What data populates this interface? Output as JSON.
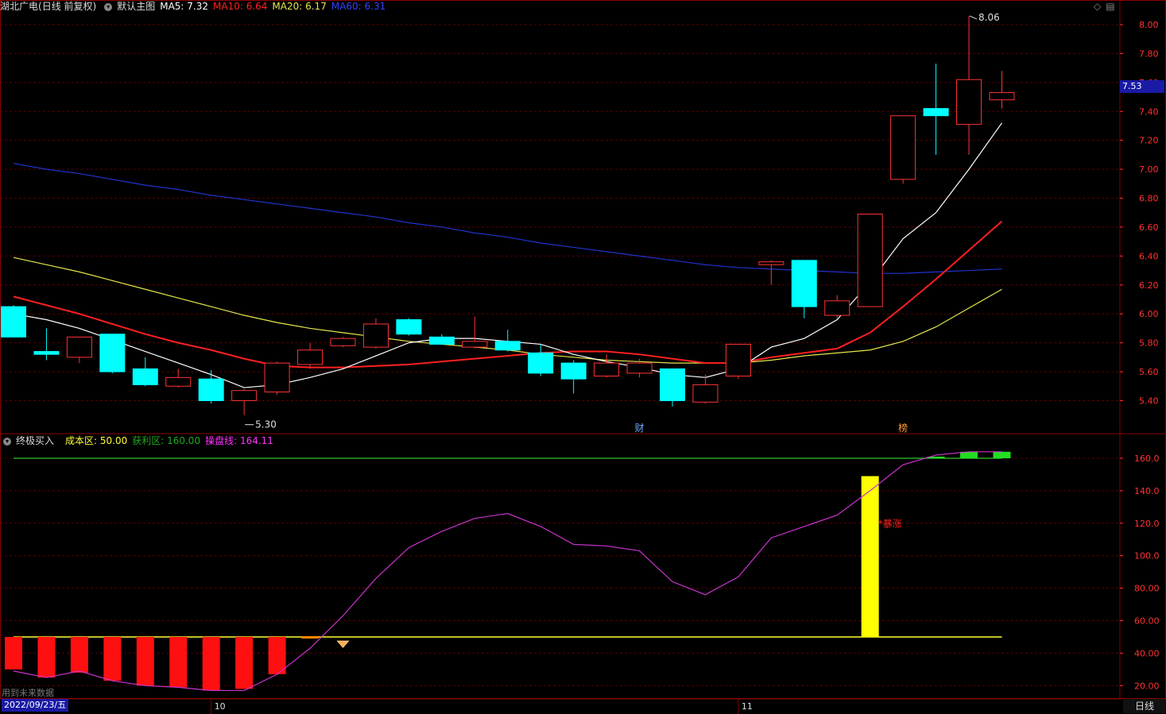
{
  "header": {
    "stock_name": "湖北广电",
    "adjust": "(日线 前复权)",
    "template_label": "默认主图",
    "ma5": "MA5: 7.32",
    "ma10": "MA10: 6.64",
    "ma20": "MA20: 6.17",
    "ma60": "MA60: 6.31"
  },
  "top_icons": {
    "diamond": "◇",
    "square": "▤"
  },
  "indicator_header": {
    "name": "终极买入",
    "cost_zone": "成本区: 50.00",
    "profit_zone": "获利区: 160.00",
    "operation_line": "操盘线: 164.11"
  },
  "price_axis": {
    "labels": [
      "8.00",
      "7.80",
      "7.60",
      "7.40",
      "7.20",
      "7.00",
      "6.80",
      "6.60",
      "6.40",
      "6.20",
      "6.00",
      "5.80",
      "5.60",
      "5.40"
    ],
    "values": [
      8.0,
      7.8,
      7.6,
      7.4,
      7.2,
      7.0,
      6.8,
      6.6,
      6.4,
      6.2,
      6.0,
      5.8,
      5.6,
      5.4
    ]
  },
  "current_price_tag": "7.53",
  "high_label": "8.06",
  "low_label": "5.30",
  "event_markers": [
    "财",
    "榜"
  ],
  "indicator_axis": {
    "labels": [
      "160.0",
      "140.0",
      "120.0",
      "100.0",
      "80.00",
      "60.00",
      "40.00",
      "20.00"
    ],
    "values": [
      160,
      140,
      120,
      100,
      80,
      60,
      40,
      20
    ]
  },
  "surge_label": "*暴涨",
  "bottom": {
    "future_data_note": "用到未来数据",
    "date": "2022/09/23/五",
    "month_oct": "10",
    "month_nov": "11",
    "period": "日线"
  },
  "colors": {
    "up": "#ff3333",
    "down": "#00ffff",
    "ma5": "#ffffff",
    "ma10": "#ff2020",
    "ma20": "#e6e64d",
    "ma60": "#2233cc",
    "grid": "#5a0000",
    "axis_text": "#ff3333"
  },
  "chart_data": {
    "type": "candlestick",
    "candles": [
      {
        "o": 6.05,
        "h": 6.06,
        "l": 5.84,
        "c": 5.84
      },
      {
        "o": 5.74,
        "h": 5.9,
        "l": 5.68,
        "c": 5.72
      },
      {
        "o": 5.7,
        "h": 5.84,
        "l": 5.66,
        "c": 5.84
      },
      {
        "o": 5.86,
        "h": 5.86,
        "l": 5.59,
        "c": 5.6
      },
      {
        "o": 5.62,
        "h": 5.7,
        "l": 5.5,
        "c": 5.51
      },
      {
        "o": 5.5,
        "h": 5.62,
        "l": 5.49,
        "c": 5.56
      },
      {
        "o": 5.55,
        "h": 5.61,
        "l": 5.38,
        "c": 5.4
      },
      {
        "o": 5.4,
        "h": 5.48,
        "l": 5.3,
        "c": 5.47
      },
      {
        "o": 5.46,
        "h": 5.67,
        "l": 5.44,
        "c": 5.66
      },
      {
        "o": 5.65,
        "h": 5.8,
        "l": 5.62,
        "c": 5.75
      },
      {
        "o": 5.78,
        "h": 5.84,
        "l": 5.77,
        "c": 5.83
      },
      {
        "o": 5.77,
        "h": 5.97,
        "l": 5.76,
        "c": 5.93
      },
      {
        "o": 5.96,
        "h": 5.97,
        "l": 5.85,
        "c": 5.86
      },
      {
        "o": 5.84,
        "h": 5.86,
        "l": 5.79,
        "c": 5.79
      },
      {
        "o": 5.77,
        "h": 5.98,
        "l": 5.76,
        "c": 5.81
      },
      {
        "o": 5.81,
        "h": 5.89,
        "l": 5.74,
        "c": 5.75
      },
      {
        "o": 5.73,
        "h": 5.79,
        "l": 5.57,
        "c": 5.59
      },
      {
        "o": 5.66,
        "h": 5.68,
        "l": 5.45,
        "c": 5.55
      },
      {
        "o": 5.57,
        "h": 5.72,
        "l": 5.56,
        "c": 5.66
      },
      {
        "o": 5.59,
        "h": 5.69,
        "l": 5.56,
        "c": 5.66
      },
      {
        "o": 5.62,
        "h": 5.62,
        "l": 5.36,
        "c": 5.4
      },
      {
        "o": 5.39,
        "h": 5.58,
        "l": 5.38,
        "c": 5.51
      },
      {
        "o": 5.57,
        "h": 5.79,
        "l": 5.55,
        "c": 5.79
      },
      {
        "o": 6.34,
        "h": 6.37,
        "l": 6.2,
        "c": 6.36
      },
      {
        "o": 6.37,
        "h": 6.37,
        "l": 5.97,
        "c": 6.05
      },
      {
        "o": 5.99,
        "h": 6.13,
        "l": 5.97,
        "c": 6.09
      },
      {
        "o": 6.05,
        "h": 6.69,
        "l": 6.05,
        "c": 6.69
      },
      {
        "o": 6.93,
        "h": 7.37,
        "l": 6.9,
        "c": 7.37
      },
      {
        "o": 7.42,
        "h": 7.73,
        "l": 7.1,
        "c": 7.37
      },
      {
        "o": 7.31,
        "h": 8.06,
        "l": 7.1,
        "c": 7.62
      },
      {
        "o": 7.48,
        "h": 7.68,
        "l": 7.42,
        "c": 7.53
      }
    ],
    "ma5": [
      6.0,
      5.96,
      5.9,
      5.82,
      5.74,
      5.66,
      5.58,
      5.49,
      5.51,
      5.56,
      5.62,
      5.71,
      5.8,
      5.83,
      5.83,
      5.81,
      5.79,
      5.72,
      5.67,
      5.63,
      5.58,
      5.56,
      5.62,
      5.77,
      5.83,
      5.96,
      6.22,
      6.52,
      6.7,
      7.0,
      7.32
    ],
    "ma10": [
      6.12,
      6.06,
      6.0,
      5.93,
      5.86,
      5.8,
      5.75,
      5.69,
      5.64,
      5.63,
      5.63,
      5.64,
      5.65,
      5.67,
      5.69,
      5.71,
      5.73,
      5.74,
      5.74,
      5.72,
      5.69,
      5.66,
      5.66,
      5.7,
      5.73,
      5.76,
      5.87,
      6.05,
      6.24,
      6.44,
      6.64
    ],
    "ma20": [
      6.39,
      6.34,
      6.29,
      6.23,
      6.17,
      6.11,
      6.05,
      5.99,
      5.94,
      5.9,
      5.87,
      5.84,
      5.81,
      5.79,
      5.77,
      5.75,
      5.72,
      5.7,
      5.68,
      5.67,
      5.66,
      5.66,
      5.66,
      5.68,
      5.71,
      5.73,
      5.75,
      5.81,
      5.91,
      6.04,
      6.17
    ],
    "ma60": [
      7.04,
      7.0,
      6.97,
      6.93,
      6.89,
      6.86,
      6.82,
      6.79,
      6.76,
      6.73,
      6.7,
      6.67,
      6.63,
      6.6,
      6.56,
      6.53,
      6.49,
      6.46,
      6.43,
      6.4,
      6.37,
      6.34,
      6.32,
      6.31,
      6.3,
      6.29,
      6.28,
      6.28,
      6.29,
      6.3,
      6.31
    ],
    "indicator_line": [
      29,
      25,
      29,
      23,
      20,
      19,
      17,
      17,
      27,
      43,
      63,
      86,
      105,
      115,
      123,
      126,
      118,
      107,
      106,
      103,
      84,
      76,
      87,
      111,
      118,
      125,
      140,
      156,
      162,
      164,
      164
    ],
    "cost_zone": 50,
    "profit_zone": 160,
    "red_bars": [
      30,
      25,
      28,
      23,
      20,
      19,
      17,
      18,
      27
    ],
    "surge_bar": {
      "index": 26,
      "value": 149
    },
    "green_bars": [
      {
        "index": 28,
        "from": 160,
        "to": 161
      },
      {
        "index": 29,
        "from": 160,
        "to": 164
      },
      {
        "index": 30,
        "from": 160,
        "to": 164
      }
    ],
    "buy_marker_index": 10
  }
}
